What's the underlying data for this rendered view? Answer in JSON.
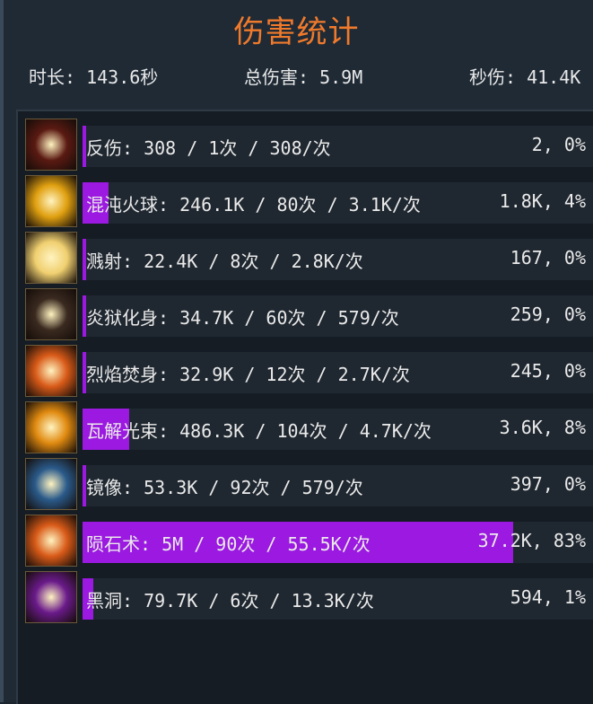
{
  "title": "伤害统计",
  "stats": {
    "duration": "时长: 143.6秒",
    "total_damage": "总伤害: 5.9M",
    "dps": "秒伤: 41.4K"
  },
  "skills": [
    {
      "label": "反伤: 308 / 1次 / 308/次",
      "value": "2, 0%",
      "percent": 0,
      "icon": "thorns-icon",
      "color": "#5a1a12"
    },
    {
      "label": "混沌火球: 246.1K / 80次 / 3.1K/次",
      "value": "1.8K, 4%",
      "percent": 4,
      "icon": "chaos-fireball-icon",
      "color": "#e0a010"
    },
    {
      "label": "溅射: 22.4K / 8次 / 2.8K/次",
      "value": "167, 0%",
      "percent": 0,
      "icon": "splash-burst-icon",
      "color": "#f0d070"
    },
    {
      "label": "炎狱化身: 34.7K / 60次 / 579/次",
      "value": "259, 0%",
      "percent": 0,
      "icon": "inferno-avatar-icon",
      "color": "#3a2a20"
    },
    {
      "label": "烈焰焚身: 32.9K / 12次 / 2.7K/次",
      "value": "245, 0%",
      "percent": 0,
      "icon": "flame-immolation-icon",
      "color": "#d85a18"
    },
    {
      "label": "瓦解光束: 486.3K / 104次 / 4.7K/次",
      "value": "3.6K, 8%",
      "percent": 8,
      "icon": "disintegrate-beam-icon",
      "color": "#e08a10"
    },
    {
      "label": "镜像: 53.3K / 92次 / 579/次",
      "value": "397, 0%",
      "percent": 0,
      "icon": "mirror-image-icon",
      "color": "#2a5a8a"
    },
    {
      "label": "陨石术: 5M / 90次 / 55.5K/次",
      "value": "37.2K, 83%",
      "percent": 83,
      "icon": "meteor-icon",
      "color": "#d85a18"
    },
    {
      "label": "黑洞: 79.7K / 6次 / 13.3K/次",
      "value": "594, 1%",
      "percent": 1,
      "icon": "black-hole-icon",
      "color": "#6a1a8a"
    }
  ]
}
